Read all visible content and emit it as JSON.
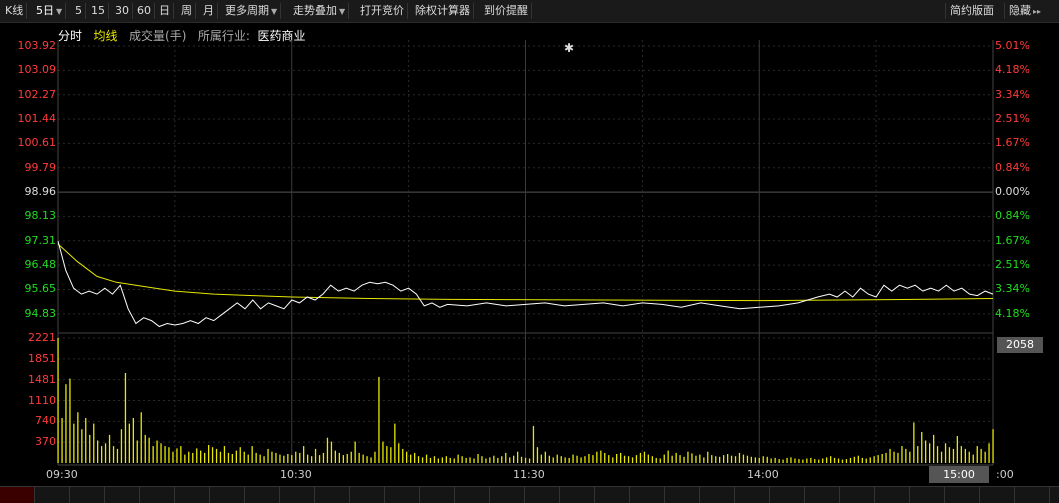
{
  "toolbar": {
    "kline": "K线",
    "period_5day": "5日",
    "periods": [
      "5",
      "15",
      "30",
      "60",
      "日",
      "周",
      "月"
    ],
    "more_periods": "更多周期",
    "trend_overlay": "走势叠加",
    "open_auction": "打开竞价",
    "ex_rights_calc": "除权计算器",
    "price_alert": "到价提醒",
    "simple_layout": "简约版面",
    "hide": "隐藏"
  },
  "indicator": {
    "intraday": "分时",
    "avg_line": "均线",
    "volume": "成交量(手)",
    "industry_label": "所属行业:",
    "industry_value": "医药商业"
  },
  "colors": {
    "up": "#ff3b3b",
    "down": "#22dd22",
    "price_line": "#ffffff",
    "avg_line": "#e8e800",
    "volume_bar": "#e8e800",
    "grid": "#2a2a2a"
  },
  "price_axis": {
    "left": [
      "103.92",
      "103.09",
      "102.27",
      "101.44",
      "100.61",
      "99.79",
      "98.96",
      "98.13",
      "97.31",
      "96.48",
      "95.65",
      "94.83"
    ],
    "right": [
      "5.01%",
      "4.18%",
      "3.34%",
      "2.51%",
      "1.67%",
      "0.84%",
      "0.00%",
      "0.84%",
      "1.67%",
      "2.51%",
      "3.34%",
      "4.18%"
    ],
    "prev_close": 98.96,
    "max": 103.92,
    "min": 94.0
  },
  "volume_axis": {
    "labels": [
      "2221",
      "1851",
      "1481",
      "1110",
      "740",
      "370"
    ],
    "max": 2221,
    "current": "2058"
  },
  "time_axis": {
    "labels": [
      "09:30",
      "10:30",
      "11:30",
      "14:00"
    ],
    "current": "15:00",
    "trailing": ":00"
  },
  "chart_data": {
    "type": "line",
    "x_range": [
      "09:30",
      "15:00"
    ],
    "minutes": 240,
    "price_series": [
      [
        0,
        97.3
      ],
      [
        2,
        96.3
      ],
      [
        4,
        95.7
      ],
      [
        6,
        95.5
      ],
      [
        8,
        95.6
      ],
      [
        10,
        95.5
      ],
      [
        12,
        95.7
      ],
      [
        14,
        95.5
      ],
      [
        16,
        95.8
      ],
      [
        18,
        95.0
      ],
      [
        20,
        94.5
      ],
      [
        22,
        94.7
      ],
      [
        24,
        94.6
      ],
      [
        26,
        94.4
      ],
      [
        28,
        94.5
      ],
      [
        30,
        94.45
      ],
      [
        32,
        94.5
      ],
      [
        34,
        94.6
      ],
      [
        36,
        94.5
      ],
      [
        38,
        94.7
      ],
      [
        40,
        94.6
      ],
      [
        42,
        94.8
      ],
      [
        44,
        95.0
      ],
      [
        46,
        95.2
      ],
      [
        48,
        95.0
      ],
      [
        50,
        95.3
      ],
      [
        52,
        95.0
      ],
      [
        54,
        95.2
      ],
      [
        56,
        95.1
      ],
      [
        58,
        95.0
      ],
      [
        60,
        95.3
      ],
      [
        62,
        95.2
      ],
      [
        64,
        95.4
      ],
      [
        66,
        95.3
      ],
      [
        68,
        95.5
      ],
      [
        70,
        95.8
      ],
      [
        72,
        95.6
      ],
      [
        74,
        95.7
      ],
      [
        76,
        95.6
      ],
      [
        78,
        95.8
      ],
      [
        80,
        95.9
      ],
      [
        82,
        95.85
      ],
      [
        84,
        95.9
      ],
      [
        86,
        95.8
      ],
      [
        88,
        95.6
      ],
      [
        90,
        95.7
      ],
      [
        92,
        95.5
      ],
      [
        94,
        95.1
      ],
      [
        96,
        95.2
      ],
      [
        98,
        95.05
      ],
      [
        100,
        95.15
      ],
      [
        105,
        95.1
      ],
      [
        110,
        95.2
      ],
      [
        115,
        95.1
      ],
      [
        120,
        95.15
      ],
      [
        125,
        95.2
      ],
      [
        130,
        95.1
      ],
      [
        135,
        95.15
      ],
      [
        140,
        95.2
      ],
      [
        145,
        95.1
      ],
      [
        150,
        95.2
      ],
      [
        155,
        95.15
      ],
      [
        160,
        95.05
      ],
      [
        165,
        95.2
      ],
      [
        170,
        95.1
      ],
      [
        175,
        95.0
      ],
      [
        180,
        95.05
      ],
      [
        185,
        95.1
      ],
      [
        190,
        95.2
      ],
      [
        195,
        95.4
      ],
      [
        198,
        95.5
      ],
      [
        200,
        95.4
      ],
      [
        202,
        95.6
      ],
      [
        204,
        95.4
      ],
      [
        206,
        95.7
      ],
      [
        208,
        95.5
      ],
      [
        210,
        95.4
      ],
      [
        212,
        95.8
      ],
      [
        214,
        95.6
      ],
      [
        216,
        95.8
      ],
      [
        218,
        95.7
      ],
      [
        220,
        95.8
      ],
      [
        222,
        95.6
      ],
      [
        224,
        95.7
      ],
      [
        226,
        95.6
      ],
      [
        228,
        95.8
      ],
      [
        230,
        95.6
      ],
      [
        232,
        95.7
      ],
      [
        234,
        95.5
      ],
      [
        236,
        95.45
      ],
      [
        238,
        95.6
      ],
      [
        240,
        95.5
      ]
    ],
    "avg_series": [
      [
        0,
        97.2
      ],
      [
        5,
        96.6
      ],
      [
        10,
        96.1
      ],
      [
        15,
        95.9
      ],
      [
        20,
        95.8
      ],
      [
        25,
        95.7
      ],
      [
        30,
        95.6
      ],
      [
        40,
        95.5
      ],
      [
        50,
        95.45
      ],
      [
        60,
        95.4
      ],
      [
        80,
        95.35
      ],
      [
        100,
        95.32
      ],
      [
        140,
        95.3
      ],
      [
        180,
        95.28
      ],
      [
        200,
        95.3
      ],
      [
        220,
        95.32
      ],
      [
        240,
        95.35
      ]
    ],
    "volume": [
      2221,
      800,
      1400,
      1500,
      700,
      900,
      600,
      800,
      500,
      700,
      400,
      300,
      350,
      500,
      300,
      250,
      600,
      1600,
      700,
      800,
      400,
      900,
      500,
      450,
      300,
      400,
      350,
      300,
      280,
      200,
      260,
      300,
      150,
      200,
      180,
      260,
      220,
      180,
      320,
      280,
      250,
      200,
      300,
      180,
      160,
      220,
      280,
      200,
      150,
      300,
      180,
      150,
      120,
      250,
      200,
      180,
      150,
      130,
      160,
      140,
      200,
      180,
      300,
      150,
      120,
      250,
      140,
      180,
      450,
      380,
      220,
      180,
      140,
      160,
      200,
      380,
      180,
      150,
      120,
      100,
      200,
      1530,
      380,
      300,
      280,
      700,
      350,
      250,
      200,
      150,
      180,
      120,
      100,
      150,
      90,
      120,
      80,
      100,
      120,
      90,
      80,
      150,
      120,
      90,
      100,
      80,
      160,
      120,
      80,
      100,
      130,
      90,
      120,
      180,
      100,
      130,
      200,
      110,
      90,
      80,
      660,
      280,
      150,
      200,
      130,
      100,
      150,
      120,
      100,
      90,
      150,
      130,
      100,
      120,
      160,
      140,
      200,
      220,
      180,
      140,
      100,
      160,
      180,
      130,
      120,
      100,
      140,
      180,
      200,
      150,
      120,
      90,
      80,
      150,
      220,
      130,
      180,
      140,
      110,
      200,
      170,
      130,
      150,
      100,
      200,
      140,
      120,
      110,
      140,
      160,
      130,
      120,
      180,
      150,
      130,
      110,
      100,
      90,
      120,
      110,
      80,
      90,
      70,
      60,
      90,
      100,
      80,
      70,
      60,
      80,
      90,
      70,
      60,
      80,
      100,
      120,
      90,
      80,
      60,
      70,
      90,
      110,
      130,
      90,
      80,
      100,
      120,
      140,
      160,
      180,
      250,
      200,
      180,
      300,
      250,
      200,
      720,
      300,
      550,
      400,
      350,
      500,
      300,
      200,
      350,
      280,
      250,
      480,
      300,
      250,
      200,
      150,
      300,
      250,
      200,
      350,
      600
    ]
  }
}
